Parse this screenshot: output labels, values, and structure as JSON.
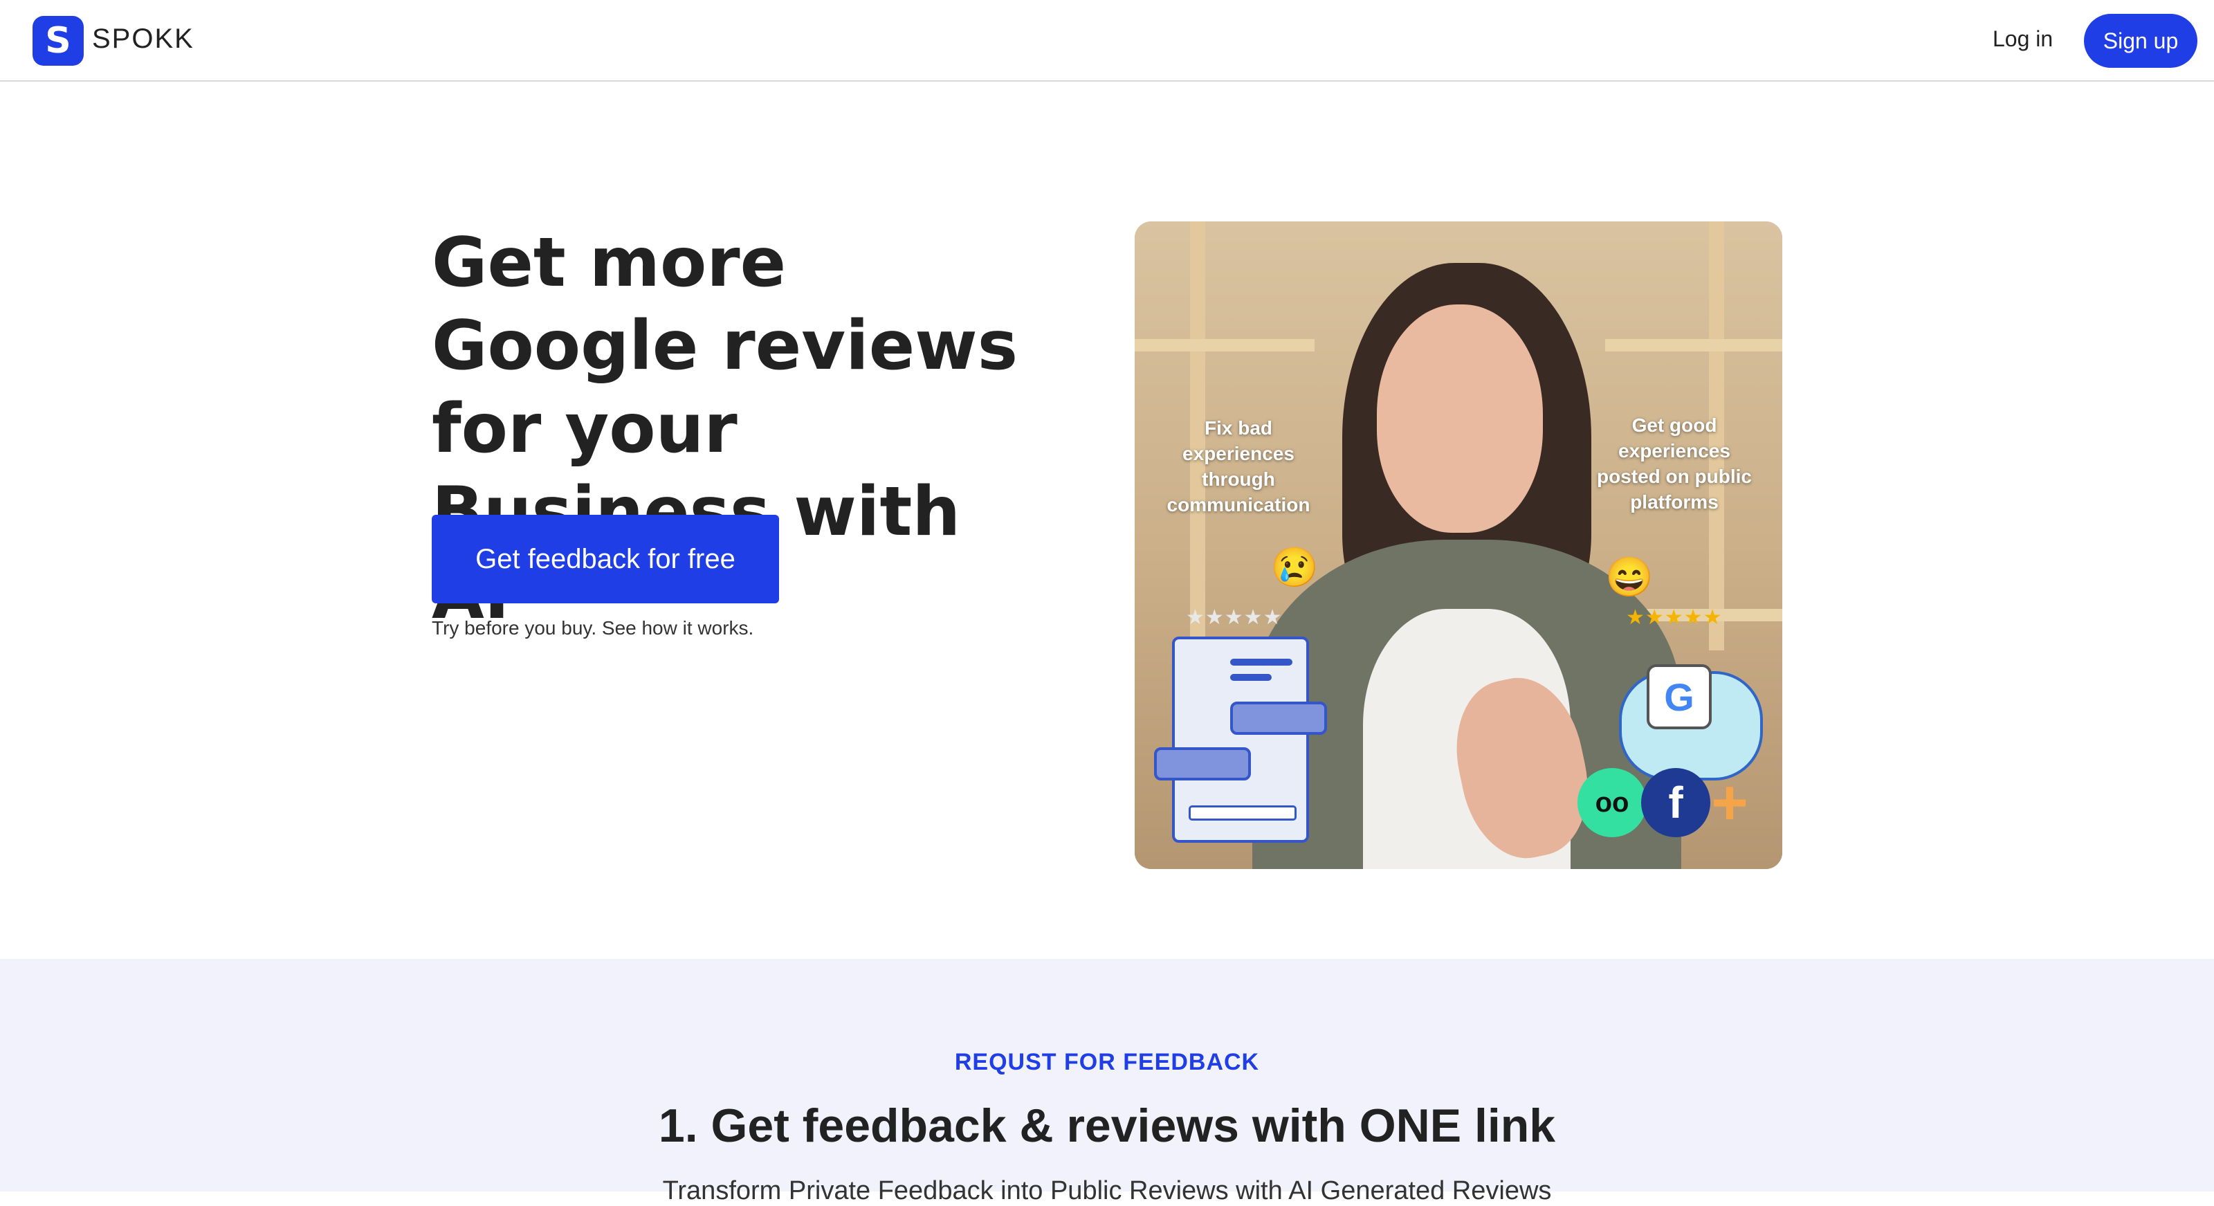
{
  "nav": {
    "logo_letter": "S",
    "brand": "SPOKK",
    "login": "Log in",
    "signup": "Sign up"
  },
  "hero": {
    "headline": "Get more Google reviews for your Business with AI",
    "cta": "Get feedback for free",
    "cta_note": "Try before you buy. See how it works.",
    "image": {
      "label_left": "Fix bad experiences through communication",
      "label_right": "Get good experiences posted on public platforms",
      "emoji_left": "😢",
      "emoji_right": "😄",
      "stars_left": "★★★★★",
      "stars_right": "★★★★★",
      "social_google": "G",
      "social_facebook": "f",
      "social_tripadvisor": "oo",
      "social_plus": "+"
    }
  },
  "section": {
    "eyebrow": "REQUST FOR FEEDBACK",
    "title": "1. Get feedback & reviews with ONE link",
    "subtitle": "Transform Private Feedback into Public Reviews with AI Generated Reviews"
  },
  "colors": {
    "primary": "#1f3ee6",
    "section_bg": "#f1f2fb",
    "text": "#222222"
  }
}
